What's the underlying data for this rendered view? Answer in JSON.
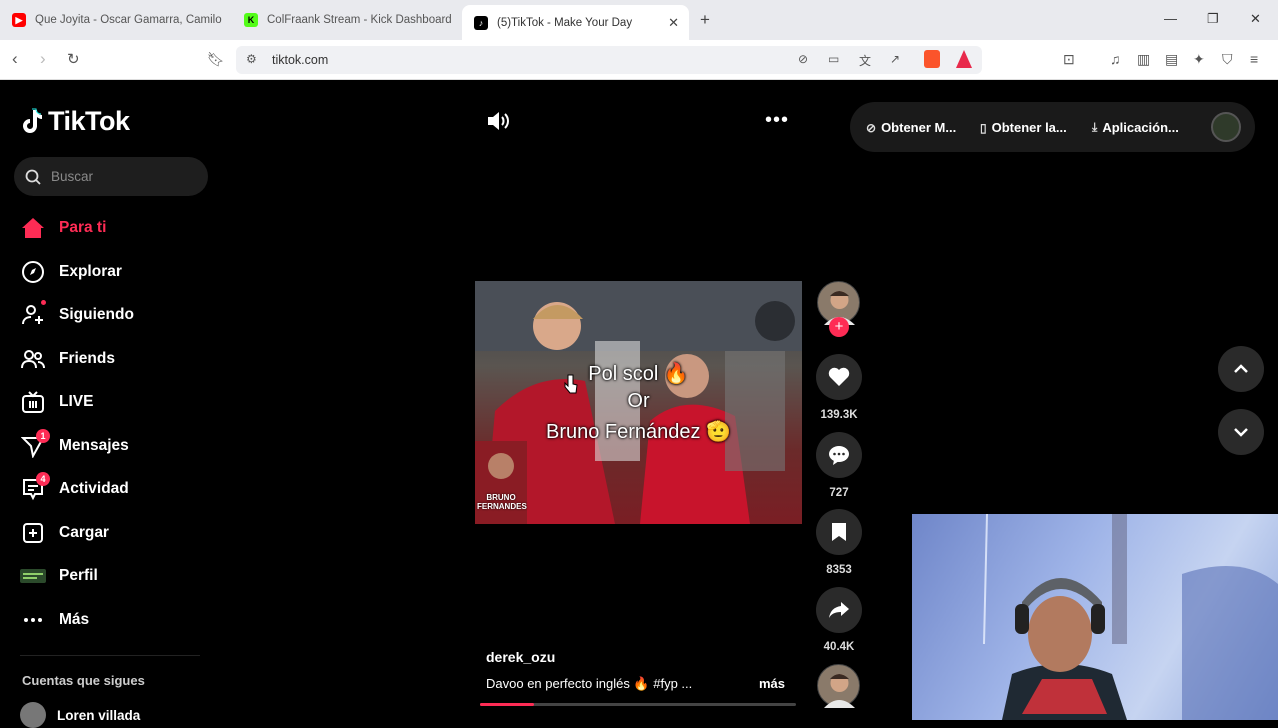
{
  "browser": {
    "tabs": [
      {
        "title": "Que Joyita - Oscar Gamarra, Camilo",
        "favicon": "youtube-icon"
      },
      {
        "title": "ColFraank Stream - Kick Dashboard",
        "favicon": "kick-icon"
      },
      {
        "title": "(5)TikTok - Make Your Day",
        "favicon": "tiktok-icon",
        "active": true
      }
    ],
    "url": "tiktok.com"
  },
  "sidebar": {
    "logo": "TikTok",
    "search_placeholder": "Buscar",
    "items": [
      {
        "label": "Para ti",
        "icon": "home-icon",
        "active": true
      },
      {
        "label": "Explorar",
        "icon": "compass-icon"
      },
      {
        "label": "Siguiendo",
        "icon": "following-icon"
      },
      {
        "label": "Friends",
        "icon": "friends-icon"
      },
      {
        "label": "LIVE",
        "icon": "live-icon"
      },
      {
        "label": "Mensajes",
        "icon": "messages-icon",
        "badge": "1"
      },
      {
        "label": "Actividad",
        "icon": "activity-icon",
        "badge": "4"
      },
      {
        "label": "Cargar",
        "icon": "upload-icon"
      },
      {
        "label": "Perfil",
        "icon": "profile-icon"
      },
      {
        "label": "Más",
        "icon": "more-icon"
      }
    ],
    "following_header": "Cuentas que sigues",
    "following": [
      {
        "name": "Loren villada"
      }
    ]
  },
  "topbar": {
    "buttons": [
      "Obtener M...",
      "Obtener la...",
      "Aplicación..."
    ]
  },
  "video": {
    "overlay_lines": [
      "Pol scol 🔥",
      "Or",
      "Bruno Fernández 🫡"
    ],
    "corner_label": [
      "BRUNO",
      "FERNANDES"
    ],
    "likes": "139.3K",
    "comments": "727",
    "saves": "8353",
    "shares": "40.4K",
    "author": "derek_ozu",
    "description": "Davoo en perfecto inglés 🔥 #fyp ...",
    "more_label": "más",
    "progress": 0.17
  },
  "colors": {
    "accent": "#fe2c55",
    "background": "#000000"
  }
}
